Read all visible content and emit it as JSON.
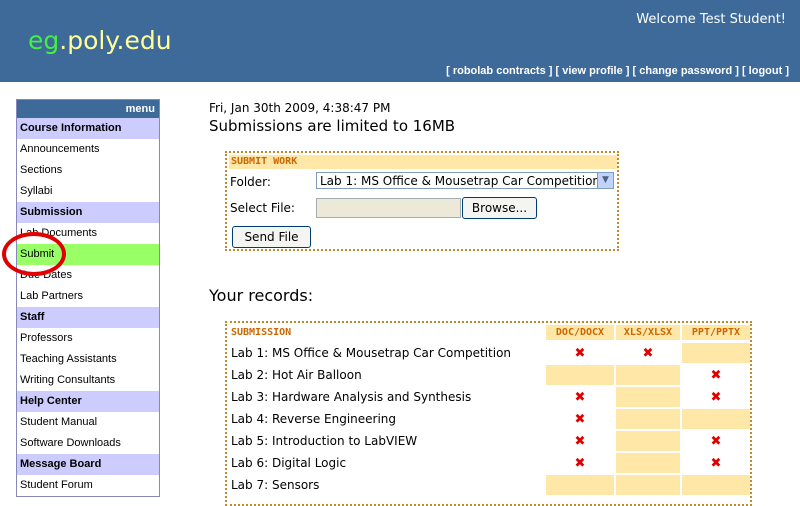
{
  "header": {
    "logo_eg": "eg",
    "logo_rest": ".poly.edu",
    "welcome": "Welcome Test Student!",
    "links": [
      "[ robolab contracts ]",
      "[ view profile ]",
      "[ change password ]",
      "[ logout ]"
    ]
  },
  "menu": {
    "title": "menu",
    "sections": [
      {
        "label": "Course Information",
        "items": [
          "Announcements",
          "Sections",
          "Syllabi"
        ]
      },
      {
        "label": "Submission",
        "items": [
          "Lab Documents",
          "Submit",
          "Due Dates",
          "Lab Partners"
        ]
      },
      {
        "label": "Staff",
        "items": [
          "Professors",
          "Teaching Assistants",
          "Writing Consultants"
        ]
      },
      {
        "label": "Help Center",
        "items": [
          "Student Manual",
          "Software Downloads"
        ]
      },
      {
        "label": "Message Board",
        "items": [
          "Student Forum"
        ]
      }
    ],
    "active_item": "Submit"
  },
  "main": {
    "datetime": "Fri, Jan 30th 2009, 4:38:47 PM",
    "limit": "Submissions are limited to 16MB",
    "submit_form": {
      "title": "SUBMIT WORK",
      "folder_label": "Folder:",
      "folder_value": "Lab 1: MS Office & Mousetrap Car Competition",
      "file_label": "Select File:",
      "browse_label": "Browse...",
      "send_label": "Send File"
    },
    "records_title": "Your records:",
    "records": {
      "headers": [
        "SUBMISSION",
        "DOC/DOCX",
        "XLS/XLSX",
        "PPT/PPTX"
      ],
      "rows": [
        {
          "name": "Lab 1: MS Office & Mousetrap Car Competition",
          "doc": "✖",
          "xls": "✖",
          "ppt": ""
        },
        {
          "name": "Lab 2: Hot Air Balloon",
          "doc": "",
          "xls": "",
          "ppt": "✖"
        },
        {
          "name": "Lab 3: Hardware Analysis and Synthesis",
          "doc": "✖",
          "xls": "",
          "ppt": "✖"
        },
        {
          "name": "Lab 4: Reverse Engineering",
          "doc": "✖",
          "xls": "",
          "ppt": ""
        },
        {
          "name": "Lab 5: Introduction to LabVIEW",
          "doc": "✖",
          "xls": "",
          "ppt": "✖"
        },
        {
          "name": "Lab 6: Digital Logic",
          "doc": "✖",
          "xls": "",
          "ppt": "✖"
        },
        {
          "name": "Lab 7: Sensors",
          "doc": "",
          "xls": "",
          "ppt": ""
        }
      ]
    }
  },
  "colors": {
    "header_bg": "#3d6a98",
    "menu_section_bg": "#ccccff",
    "active_item_bg": "#99ff66",
    "box_border": "#c08a2a",
    "box_header_bg": "#ffe7a8",
    "box_header_text": "#cc6600",
    "missing_mark": "#e00000",
    "annotation_circle": "#e00000"
  }
}
